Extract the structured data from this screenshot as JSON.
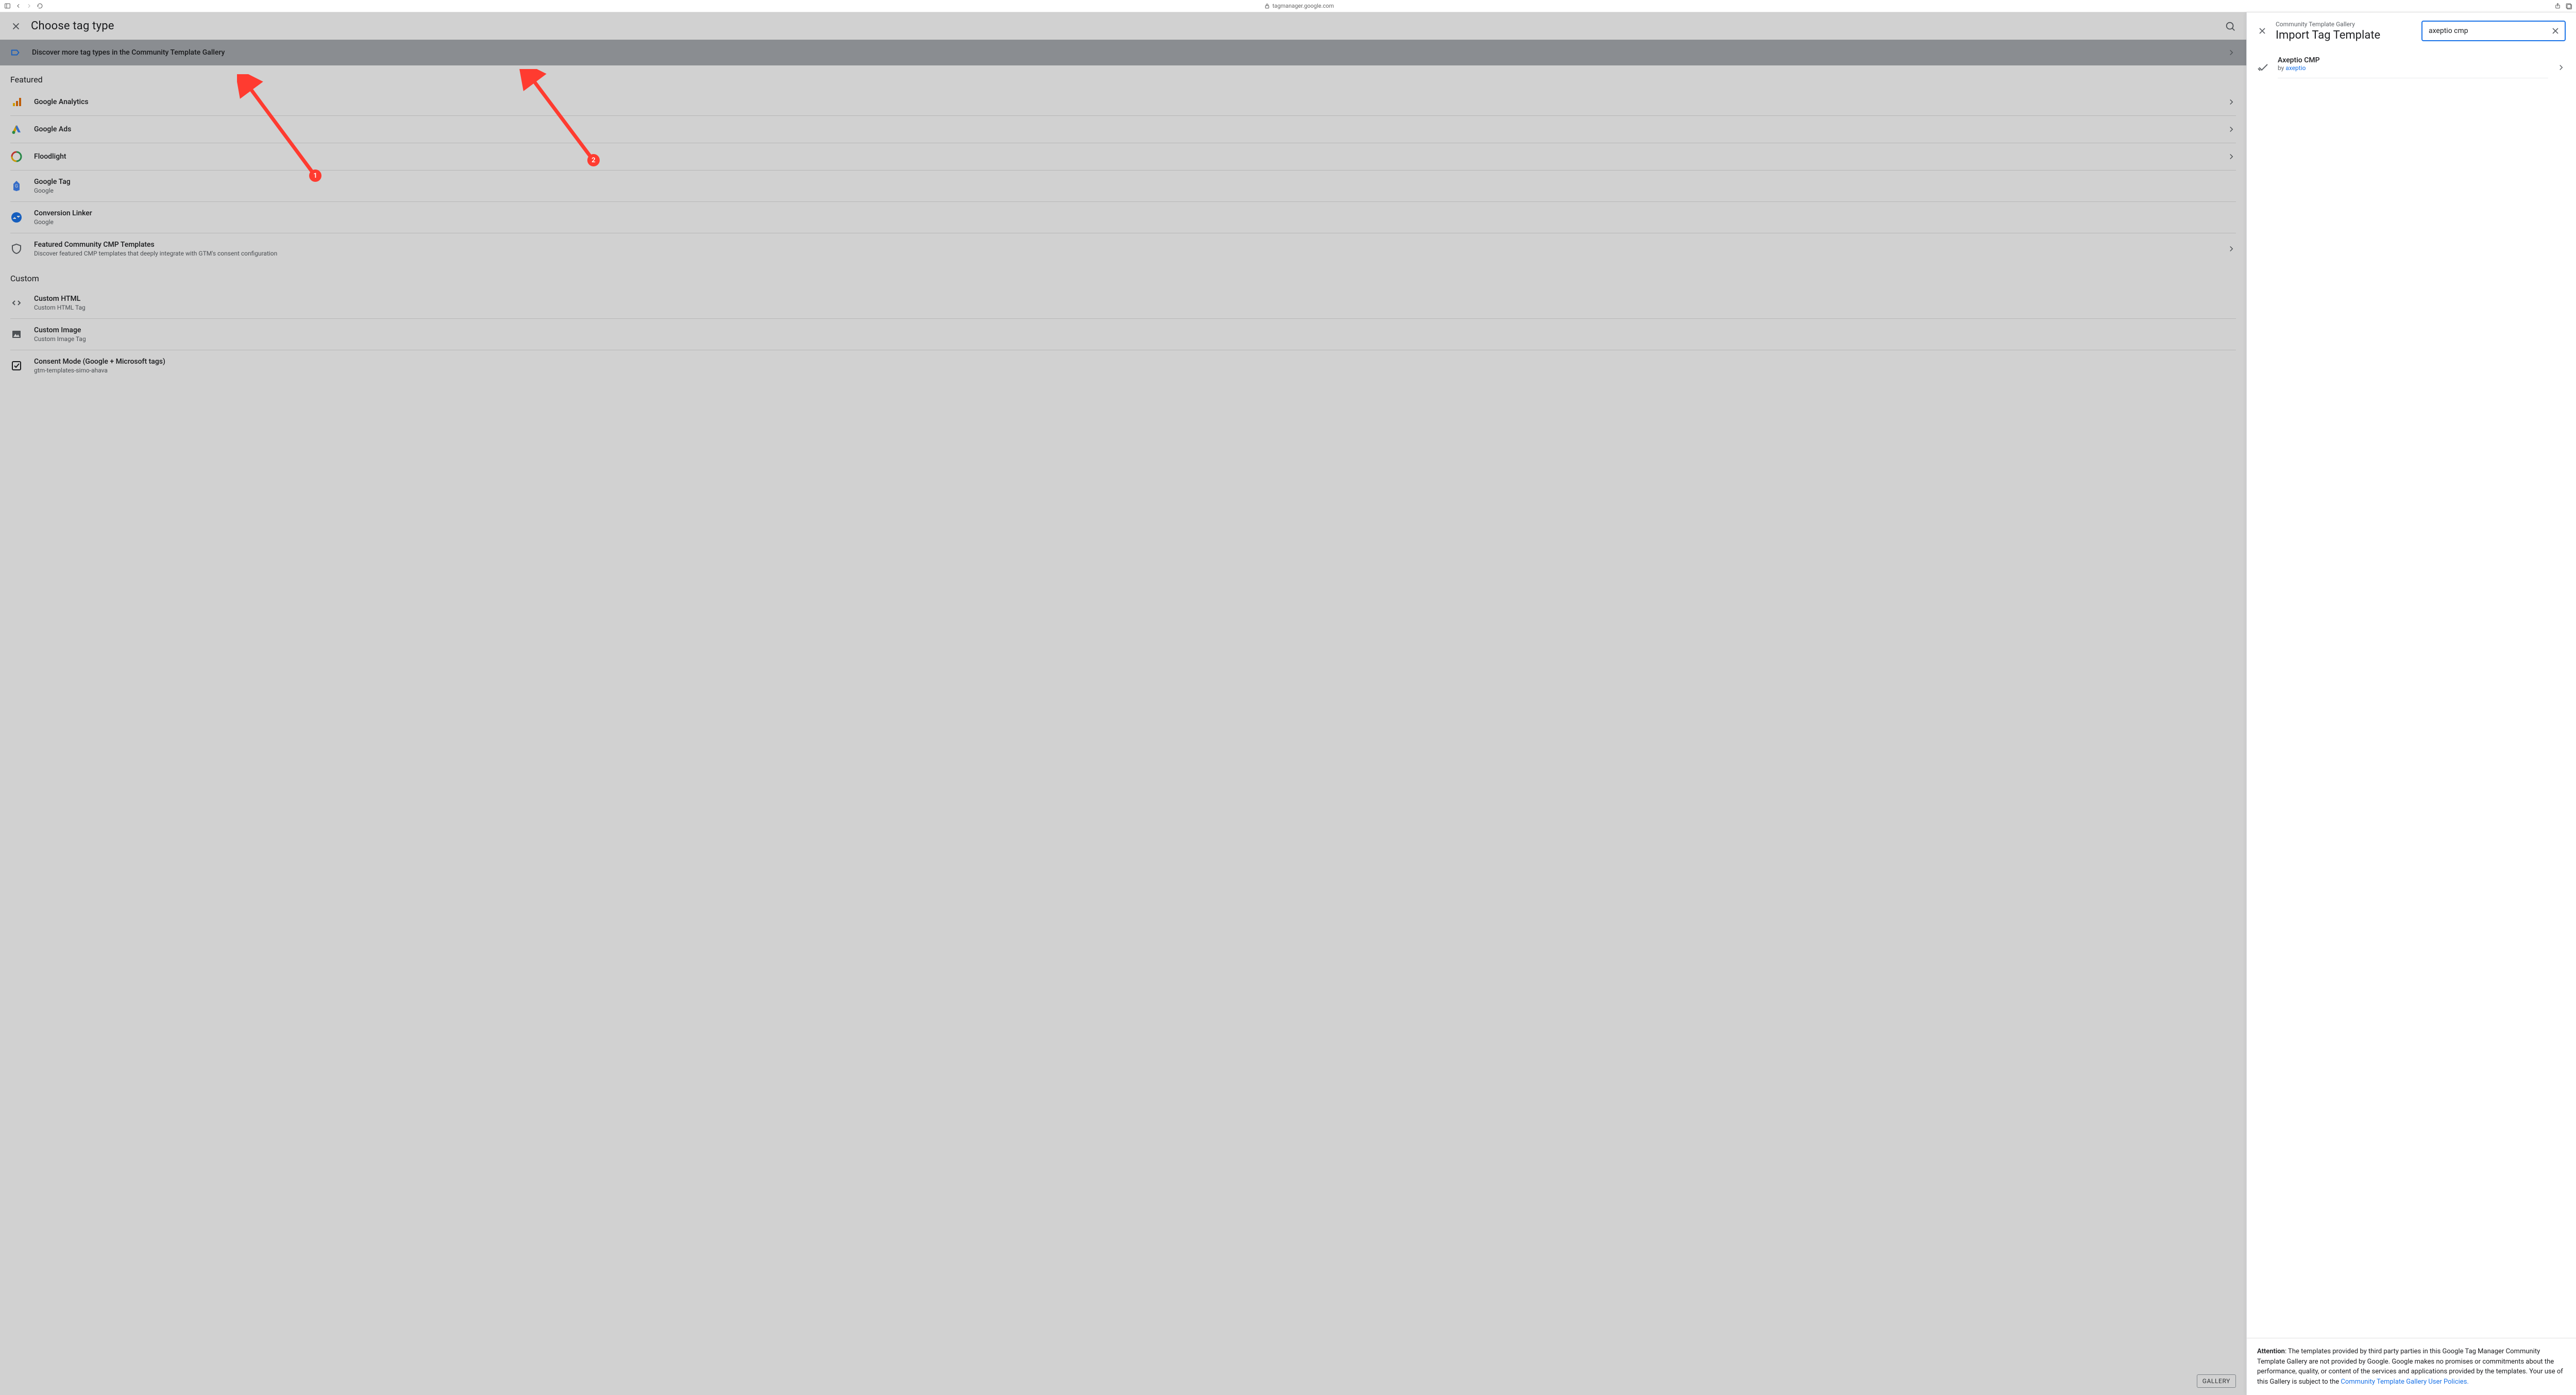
{
  "browser": {
    "url": "tagmanager.google.com"
  },
  "left": {
    "title": "Choose tag type",
    "banner": "Discover more tag types in the Community Template Gallery",
    "section_featured": "Featured",
    "section_custom": "Custom",
    "rows": [
      {
        "title": "Google Analytics",
        "sub": ""
      },
      {
        "title": "Google Ads",
        "sub": ""
      },
      {
        "title": "Floodlight",
        "sub": ""
      },
      {
        "title": "Google Tag",
        "sub": "Google"
      },
      {
        "title": "Conversion Linker",
        "sub": "Google"
      },
      {
        "title": "Featured Community CMP Templates",
        "sub": "Discover featured CMP templates that deeply integrate with GTM's consent configuration"
      }
    ],
    "custom_rows": [
      {
        "title": "Custom HTML",
        "sub": "Custom HTML Tag"
      },
      {
        "title": "Custom Image",
        "sub": "Custom Image Tag"
      },
      {
        "title": "Consent Mode (Google + Microsoft tags)",
        "sub": "gtm-templates-simo-ahava"
      }
    ],
    "gallery_btn": "GALLERY"
  },
  "right": {
    "crumb": "Community Template Gallery",
    "title": "Import Tag Template",
    "search_value": "axeptio cmp",
    "result": {
      "title": "Axeptio CMP",
      "by_prefix": "by ",
      "by_link": "axeptio"
    },
    "footer_bold": "Attention",
    "footer_text": ": The templates provided by third party parties in this Google Tag Manager Community Template Gallery are not provided by Google. Google makes no promises or commitments about the performance, quality, or content of the services and applications provided by the templates. Your use of this Gallery is subject to the ",
    "footer_link": "Community Template Gallery User Policies."
  },
  "annotations": {
    "one": "1",
    "two": "2"
  }
}
